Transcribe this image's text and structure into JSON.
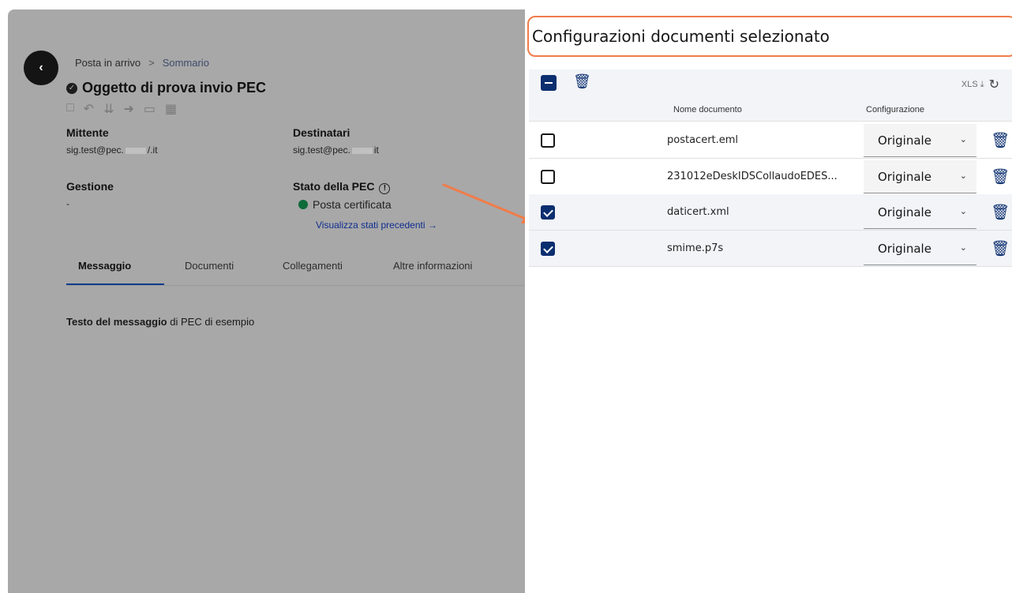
{
  "breadcrumb": {
    "parent": "Posta in arrivo",
    "separator": ">",
    "current": "Sommario"
  },
  "message": {
    "subject": "Oggetto di prova invio PEC",
    "sender_label": "Mittente",
    "sender_value_a": "sig.test@pec.",
    "sender_value_b": "/.it",
    "recipients_label": "Destinatari",
    "recipients_value_a": "sig.test@pec.",
    "recipients_value_b": "it",
    "management_label": "Gestione",
    "management_value": "-",
    "state_label": "Stato della PEC",
    "state_value": "Posta certificata",
    "state_link": "Visualizza stati precedenti →"
  },
  "tabs": [
    "Messaggio",
    "Documenti",
    "Collegamenti",
    "Altre informazioni"
  ],
  "body": {
    "bold": "Testo del messaggio",
    "rest": " di PEC di esempio"
  },
  "panel": {
    "title": "Configurazioni documenti selezionato",
    "export_label": "XLS",
    "col_name": "Nome documento",
    "col_config": "Configurazione",
    "rows": [
      {
        "name": "postacert.eml",
        "config": "Originale",
        "checked": false
      },
      {
        "name": "231012eDeskIDSCollaudoEDES...",
        "config": "Originale",
        "checked": false
      },
      {
        "name": "daticert.xml",
        "config": "Originale",
        "checked": true
      },
      {
        "name": "smime.p7s",
        "config": "Originale",
        "checked": true
      }
    ]
  },
  "colors": {
    "accent": "#0b2e6f",
    "highlight": "#f07c4a",
    "overlay": "#a8a8a8",
    "status_green": "#0e6b3a"
  },
  "icons": [
    "back-icon",
    "check-circle-icon",
    "new-doc-icon",
    "reply-icon",
    "reply-all-icon",
    "forward-icon",
    "move-icon",
    "trash-icon",
    "info-icon",
    "download-icon",
    "refresh-icon",
    "chevron-down-icon"
  ]
}
